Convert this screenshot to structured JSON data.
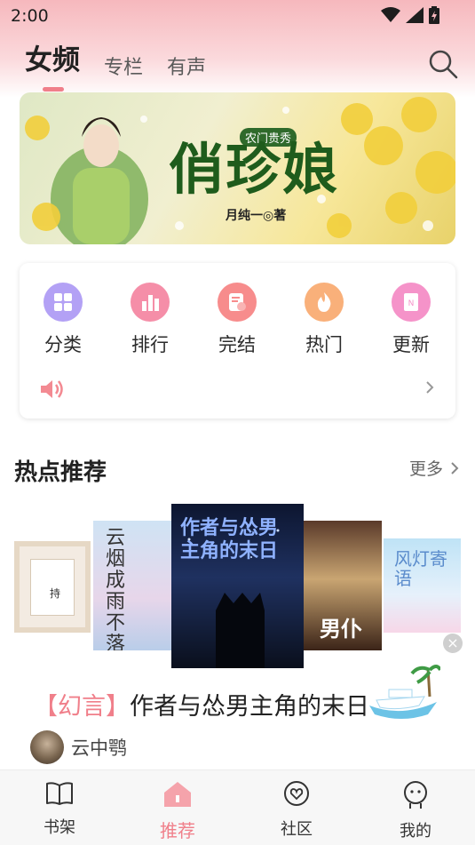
{
  "status": {
    "time": "2:00",
    "icons": [
      "wifi-icon",
      "signal-icon",
      "battery-icon"
    ]
  },
  "nav": {
    "tabs": [
      {
        "label": "女频",
        "active": true
      },
      {
        "label": "专栏",
        "active": false
      },
      {
        "label": "有声",
        "active": false
      }
    ],
    "search_icon": "search-icon"
  },
  "banner": {
    "title": "俏珍娘",
    "subtitle": "农门贵秀",
    "author": "月纯一◎著"
  },
  "categories": {
    "items": [
      {
        "label": "分类",
        "icon": "grid-icon",
        "color": "#b3a1f5"
      },
      {
        "label": "排行",
        "icon": "bar-chart-icon",
        "color": "#f58ea8"
      },
      {
        "label": "完结",
        "icon": "book-check-icon",
        "color": "#f78c8c"
      },
      {
        "label": "热门",
        "icon": "flame-icon",
        "color": "#f9b07a"
      },
      {
        "label": "更新",
        "icon": "new-book-icon",
        "color": "#f593c9"
      }
    ],
    "speaker_icon": "speaker-icon",
    "chevron_icon": "chevron-right-icon"
  },
  "section": {
    "title": "热点推荐",
    "more_label": "更多"
  },
  "covers": [
    {
      "name": "cover-1",
      "text": "持"
    },
    {
      "name": "cover-2",
      "text": "云烟成雨 不落下"
    },
    {
      "name": "cover-3",
      "text": "作者与怂男主角的末日"
    },
    {
      "name": "cover-4",
      "text": "男仆"
    },
    {
      "name": "cover-5",
      "text": "风灯寄语"
    }
  ],
  "featured": {
    "tag": "【幻言】",
    "title": "作者与怂男主角的末日",
    "author": "云中鹗",
    "close_label": "×"
  },
  "bottom_nav": [
    {
      "label": "书架",
      "icon": "bookshelf-icon",
      "active": false
    },
    {
      "label": "推荐",
      "icon": "recommend-icon",
      "active": true
    },
    {
      "label": "社区",
      "icon": "community-icon",
      "active": false
    },
    {
      "label": "我的",
      "icon": "profile-icon",
      "active": false
    }
  ],
  "colors": {
    "accent": "#f07f8a",
    "header_pink": "#f6b8bd"
  }
}
